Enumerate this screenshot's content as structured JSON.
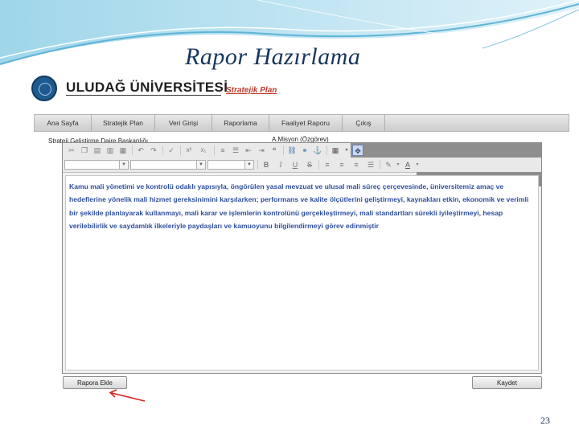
{
  "slide": {
    "title": "Rapor Hazırlama",
    "page_number": "23"
  },
  "header": {
    "university_name": "ULUDAĞ ÜNİVERSİTESİ",
    "subtitle_link": "Stratejik Plan"
  },
  "nav": {
    "items": [
      "Ana Sayfa",
      "Stratejik Plan",
      "Veri Girişi",
      "Raporlama",
      "Faaliyet Raporu",
      "Çıkış"
    ]
  },
  "form": {
    "department": "Strateji Geliştirme Daire Başkanlığı",
    "section": "A.Misyon (Özgörev)"
  },
  "toolbar": {
    "bold": "B",
    "italic": "I",
    "underline": "U",
    "strike": "S",
    "superscript": "x²",
    "subscript": "x₁",
    "font_color": "A"
  },
  "editor": {
    "content": "Kamu mali yönetimi ve kontrolü odaklı yapısıyla, öngörülen yasal mevzuat ve ulusal mali süreç çerçevesinde, üniversitemiz amaç ve hedeflerine yönelik mali hizmet gereksinimini karşılarken; performans ve kalite ölçütlerini geliştirmeyi, kaynakları etkin, ekonomik ve verimli bir şekilde planlayarak kullanmayı, mali karar ve işlemlerin kontrolünü gerçekleştirmeyi, mali standartları sürekli iyileştirmeyi, hesap verilebilirlik ve saydamlık ilkeleriyle paydaşları ve kamuoyunu bilgilendirmeyi görev edinmiştir"
  },
  "buttons": {
    "add_to_report": "Rapora Ekle",
    "save": "Kaydet"
  },
  "colors": {
    "title": "#17365d",
    "editor_text": "#2d4fa0",
    "link": "#c0392b",
    "annotation_arrow": "#d62020"
  }
}
